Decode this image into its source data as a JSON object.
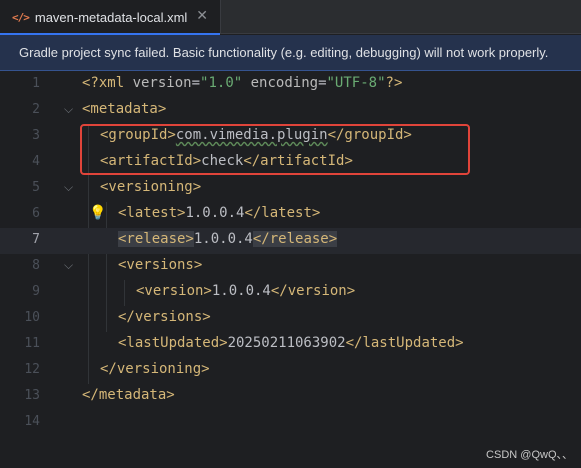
{
  "tab": {
    "icon": "</>",
    "title": "maven-metadata-local.xml",
    "close": "✕"
  },
  "banner": {
    "text": "Gradle project sync failed. Basic functionality (e.g. editing, debugging) will not work properly."
  },
  "editor": {
    "current_line": 7,
    "line_numbers": [
      "1",
      "2",
      "3",
      "4",
      "5",
      "6",
      "7",
      "8",
      "9",
      "10",
      "11",
      "12",
      "13",
      "14"
    ],
    "lines": {
      "l1": {
        "p1": "<?xml ",
        "a1": "version",
        "eq1": "=",
        "s1": "\"1.0\"",
        "sp": " ",
        "a2": "encoding",
        "eq2": "=",
        "s2": "\"UTF-8\"",
        "p2": "?>"
      },
      "l2": {
        "t1": "<metadata>"
      },
      "l3": {
        "t1": "<groupId>",
        "v": "com.vimedia.plugin",
        "t2": "</groupId>"
      },
      "l4": {
        "t1": "<artifactId>",
        "v": "check",
        "t2": "</artifactId>"
      },
      "l5": {
        "t1": "<versioning>"
      },
      "l6": {
        "t1": "<latest>",
        "v": "1.0.0.4",
        "t2": "</latest>"
      },
      "l7": {
        "t1": "<release>",
        "v": "1.0.0.4",
        "t2": "</release>"
      },
      "l8": {
        "t1": "<versions>"
      },
      "l9": {
        "t1": "<version>",
        "v": "1.0.0.4",
        "t2": "</version>"
      },
      "l10": {
        "t1": "</versions>"
      },
      "l11": {
        "t1": "<lastUpdated>",
        "v": "20250211063902",
        "t2": "</lastUpdated>"
      },
      "l12": {
        "t1": "</versioning>"
      },
      "l13": {
        "t1": "</metadata>"
      }
    },
    "fold_icon": "chevron-down-icon",
    "intention_icon": "lightbulb-icon"
  },
  "watermark": "CSDN @QwQ、、",
  "colors": {
    "tag": "#d5b778",
    "string": "#6aab73",
    "highlight_box": "#e0443a",
    "banner_bg": "#25324d"
  }
}
